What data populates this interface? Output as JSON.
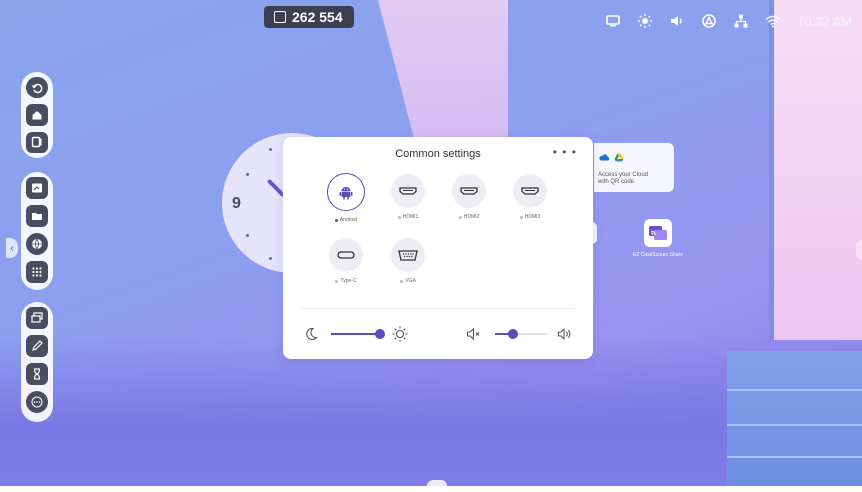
{
  "top_badge": {
    "count": "262 554"
  },
  "status_bar": {
    "time": "10:32 AM"
  },
  "panel": {
    "title": "Common settings",
    "more": "• • •",
    "sources": [
      {
        "label": "Android",
        "icon": "android-icon",
        "active": true
      },
      {
        "label": "HDMI1",
        "icon": "hdmi-port-icon",
        "active": false
      },
      {
        "label": "HDMI2",
        "icon": "hdmi-port-icon",
        "active": false
      },
      {
        "label": "HDMI3",
        "icon": "hdmi-port-icon",
        "active": false
      },
      {
        "label": "Type-C",
        "icon": "usb-c-icon",
        "active": false
      },
      {
        "label": "VGA",
        "icon": "vga-port-icon",
        "active": false
      }
    ],
    "brightness": {
      "value_percent": 100,
      "icon_low": "moon-icon",
      "icon_high": "sun-icon"
    },
    "volume": {
      "value_percent": 35,
      "icon_low": "mute-icon",
      "icon_high": "volume-high-icon"
    }
  },
  "cloud_card": {
    "line1": "Access your Cloud",
    "line2": "with QR code",
    "icons": [
      "onedrive-icon",
      "google-drive-icon"
    ]
  },
  "desktop_app": {
    "label": "EZ Cast/Screen Share",
    "icon": "screen-share-icon"
  },
  "clock": {
    "numeral": "9"
  },
  "colors": {
    "accent": "#5e4ab8",
    "sidebar_button": "#4a4d62",
    "badge_bg": "#3c3f52"
  }
}
